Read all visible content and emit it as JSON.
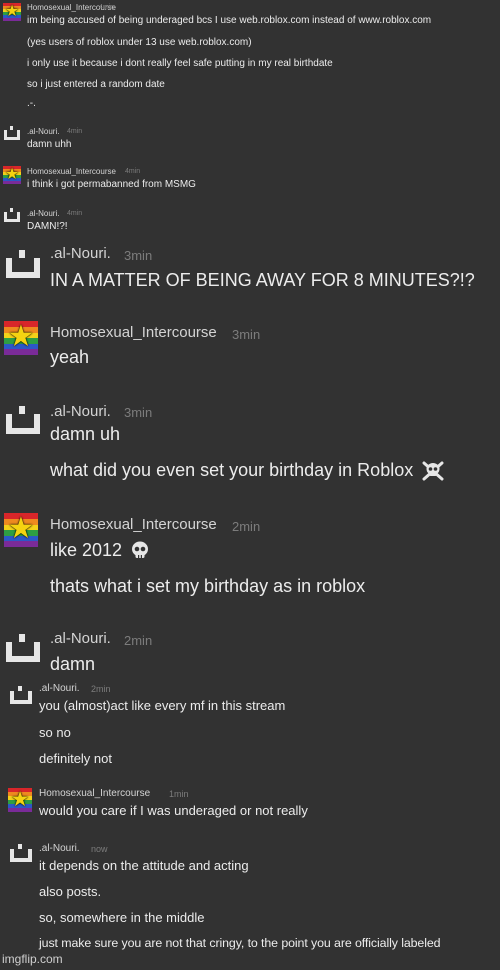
{
  "colors": {
    "background": "#323232",
    "text": "#ececec",
    "username": "#d4d4d4",
    "timestamp": "#7c7c7c",
    "avatar_face": "#e6e6e6",
    "pride_stripes": [
      "#d8262a",
      "#ee8a1f",
      "#f3d21a",
      "#2e9e43",
      "#2c58c7",
      "#7a2b98"
    ],
    "star": "#f5d311"
  },
  "messages": [
    {
      "id": "m1",
      "user": "Homosexual_Intercourse",
      "time": "4min",
      "avatar": "pride-star-avatar",
      "lines": [
        "im being accused of being underaged bcs I use web.roblox.com instead of www.roblox.com",
        "(yes users of roblox under 13 use web.roblox.com)",
        "i only use it because i dont really feel safe putting in my real birthdate",
        "so i just entered a random date",
        ".-."
      ]
    },
    {
      "id": "m2",
      "user": ".al-Nouri.",
      "time": "4min",
      "avatar": "smile-face-avatar",
      "lines": [
        "damn uhh"
      ]
    },
    {
      "id": "m3",
      "user": "Homosexual_Intercourse",
      "time": "4min",
      "avatar": "pride-star-avatar",
      "lines": [
        "i think i got permabanned from MSMG"
      ]
    },
    {
      "id": "m4",
      "user": ".al-Nouri.",
      "time": "4min",
      "avatar": "smile-face-avatar",
      "lines": [
        "DAMN!?!"
      ]
    },
    {
      "id": "m5",
      "user": ".al-Nouri.",
      "time": "3min",
      "avatar": "smile-face-avatar",
      "lines": [
        "IN A MATTER OF BEING AWAY FOR 8 MINUTES?!?"
      ]
    },
    {
      "id": "m6",
      "user": "Homosexual_Intercourse",
      "time": "3min",
      "avatar": "pride-star-avatar",
      "lines": [
        "yeah"
      ]
    },
    {
      "id": "m7",
      "user": ".al-Nouri.",
      "time": "3min",
      "avatar": "smile-face-avatar",
      "lines": [
        "damn uh",
        "what did you even set your birthday in Roblox"
      ],
      "emoji": "skull-and-crossbones-emoji"
    },
    {
      "id": "m8",
      "user": "Homosexual_Intercourse",
      "time": "2min",
      "avatar": "pride-star-avatar",
      "lines": [
        "like 2012",
        "thats what i set my birthday as in roblox"
      ],
      "emoji": "skull-emoji"
    },
    {
      "id": "m9",
      "user": ".al-Nouri.",
      "time": "2min",
      "avatar": "smile-face-avatar",
      "lines": [
        "damn"
      ]
    },
    {
      "id": "m10",
      "user": ".al-Nouri.",
      "time": "2min",
      "avatar": "smile-face-avatar",
      "lines": [
        "you (almost)act like every mf in this stream",
        "so no",
        "definitely not"
      ]
    },
    {
      "id": "m11",
      "user": "Homosexual_Intercourse",
      "time": "1min",
      "avatar": "pride-star-avatar",
      "lines": [
        "would you care if I was underaged or not really"
      ]
    },
    {
      "id": "m12",
      "user": ".al-Nouri.",
      "time": "now",
      "avatar": "smile-face-avatar",
      "lines": [
        "it depends on the attitude and acting",
        "also posts.",
        "so, somewhere in the middle",
        "just make sure you are not that cringy, to the point you are officially labeled"
      ]
    }
  ],
  "watermark": "imgflip.com"
}
